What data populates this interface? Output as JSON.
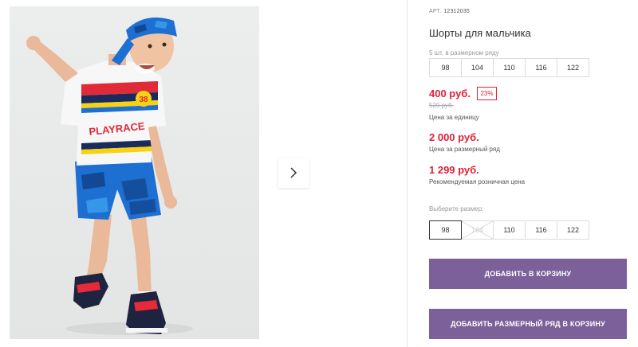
{
  "product": {
    "sku_label": "АРТ.",
    "sku": "12312035",
    "title": "Шорты для мальчика",
    "size_line_label": "5 шт. в размерном ряду",
    "size_line": [
      "98",
      "104",
      "110",
      "116",
      "122"
    ],
    "price": "400 руб.",
    "discount": "23%",
    "old_price": "520 руб.",
    "unit_price_label": "Цена за единицу",
    "line_price": "2 000 руб.",
    "line_price_label": "Цена за размерный ряд",
    "retail_price": "1 299 руб.",
    "retail_price_label": "Рекомендуемая розничная цена",
    "choose_size_label": "Выберите размер:",
    "sizes": [
      "98",
      "104",
      "110",
      "116",
      "122"
    ],
    "selected_size": "98",
    "unavailable_size": "104"
  },
  "buttons": {
    "add_to_cart": "ДОБАВИТЬ В КОРЗИНУ",
    "add_line_to_cart": "ДОБАВИТЬ РАЗМЕРНЫЙ РЯД В КОРЗИНУ"
  },
  "photo_print": {
    "shirt_text": "PLAYRACE",
    "number": "38"
  },
  "colors": {
    "accent": "#7b6099",
    "price_red": "#e21e36"
  },
  "icons": {
    "next": "chevron-right-icon"
  }
}
